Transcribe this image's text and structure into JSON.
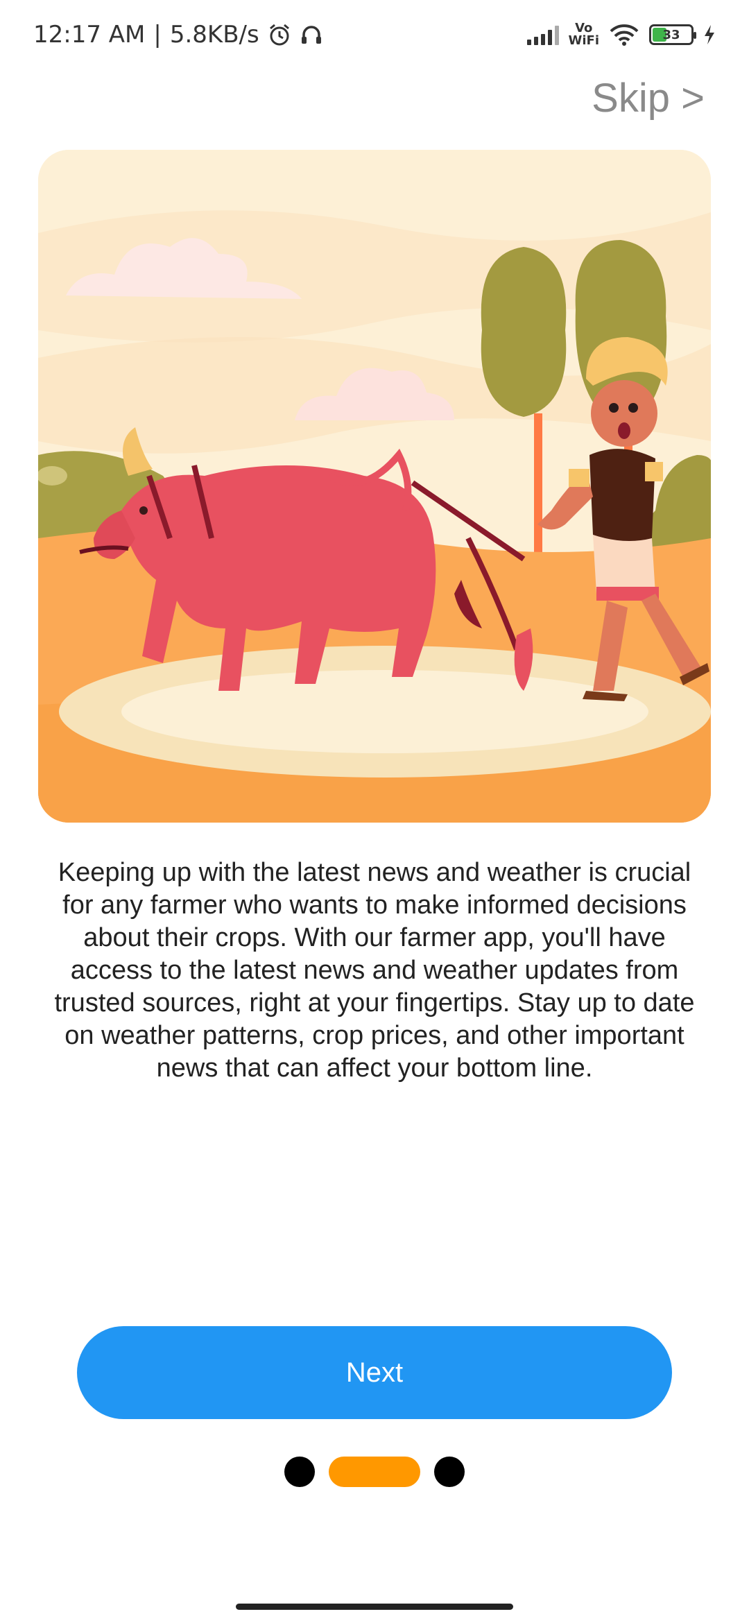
{
  "status_bar": {
    "time": "12:17 AM",
    "speed": "5.8KB/s",
    "vowifi_top": "Vo",
    "vowifi_bottom": "WiFi",
    "battery": "33"
  },
  "skip_label": "Skip >",
  "description": "Keeping up with the latest news and weather is crucial for any farmer who wants to make informed decisions about their crops. With our farmer app, you'll have access to the latest news and weather updates from trusted sources, right at your fingertips. Stay up to date on weather patterns, crop prices, and other important news that can affect your bottom line.",
  "next_label": "Next",
  "pagination": {
    "total": 3,
    "active_index": 1
  },
  "colors": {
    "accent": "#2196f3",
    "active_dot": "#ff9800"
  }
}
